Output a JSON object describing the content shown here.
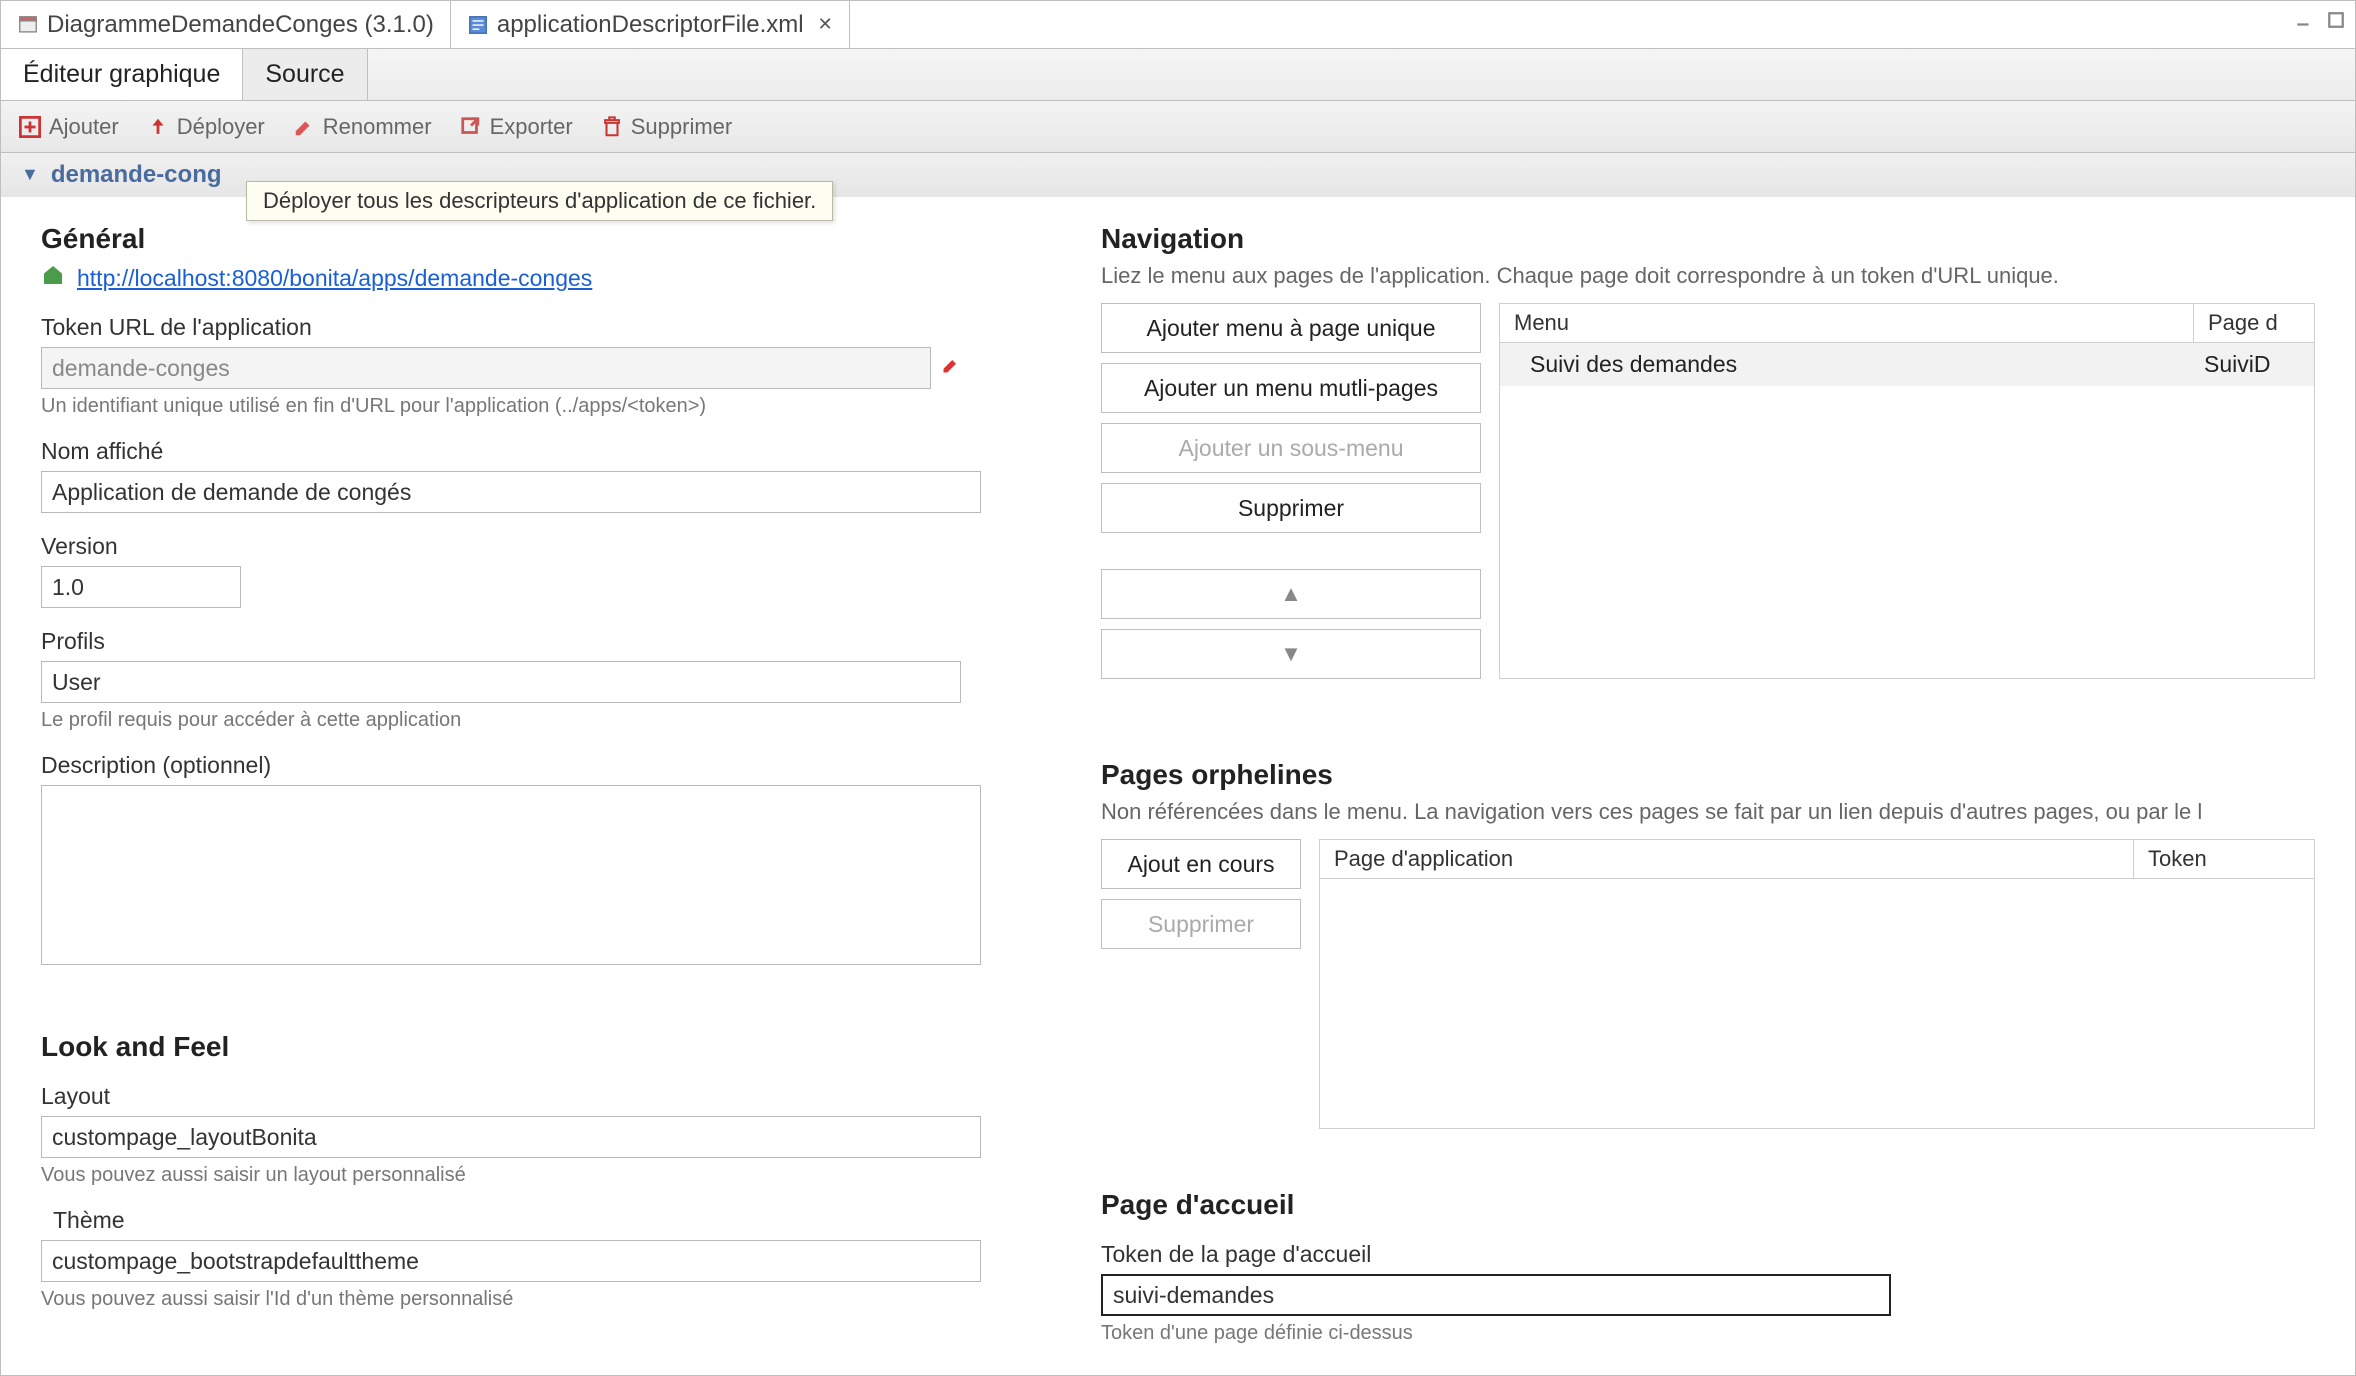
{
  "tabs": {
    "tab1": "DiagrammeDemandeConges (3.1.0)",
    "tab2": "applicationDescriptorFile.xml"
  },
  "subtabs": {
    "graph": "Éditeur graphique",
    "source": "Source"
  },
  "toolbar": {
    "add": "Ajouter",
    "deploy": "Déployer",
    "rename": "Renommer",
    "export": "Exporter",
    "delete": "Supprimer"
  },
  "tooltip": "Déployer tous les descripteurs d'application de ce fichier.",
  "section_header": "demande-cong",
  "general": {
    "title": "Général",
    "url": "http://localhost:8080/bonita/apps/demande-conges",
    "token_label": "Token URL de l'application",
    "token_value": "demande-conges",
    "token_hint": "Un identifiant unique utilisé en fin d'URL pour l'application (../apps/<token>)",
    "displayname_label": "Nom affiché",
    "displayname_value": "Application de demande de congés",
    "version_label": "Version",
    "version_value": "1.0",
    "profiles_label": "Profils",
    "profiles_value": "User",
    "profiles_hint": "Le profil requis pour accéder à cette application",
    "desc_label": "Description (optionnel)",
    "desc_value": ""
  },
  "look": {
    "title": "Look and Feel",
    "layout_label": "Layout",
    "layout_value": "custompage_layoutBonita",
    "layout_hint": "Vous pouvez aussi saisir un layout personnalisé",
    "theme_label": "Thème",
    "theme_value": "custompage_bootstrapdefaulttheme",
    "theme_hint": "Vous pouvez aussi saisir l'Id d'un thème personnalisé"
  },
  "nav": {
    "title": "Navigation",
    "desc": "Liez le menu aux pages de l'application. Chaque page doit correspondre à un token d'URL unique.",
    "btn_add_single": "Ajouter menu à page unique",
    "btn_add_multi": "Ajouter un menu mutli-pages",
    "btn_add_sub": "Ajouter un sous-menu",
    "btn_delete": "Supprimer",
    "btn_up": "▲",
    "btn_down": "▼",
    "col_menu": "Menu",
    "col_page": "Page d",
    "row_menu": "Suivi des demandes",
    "row_page": "SuiviD"
  },
  "orph": {
    "title": "Pages orphelines",
    "desc": "Non référencées dans le menu. La navigation vers ces pages se fait par un lien depuis d'autres pages, ou par le l",
    "btn_add": "Ajout en cours",
    "btn_delete": "Supprimer",
    "col_app": "Page d'application",
    "col_tok": "Token"
  },
  "home": {
    "title": "Page d'accueil",
    "label": "Token de la page d'accueil",
    "value": "suivi-demandes",
    "hint": "Token d'une page définie ci-dessus"
  }
}
